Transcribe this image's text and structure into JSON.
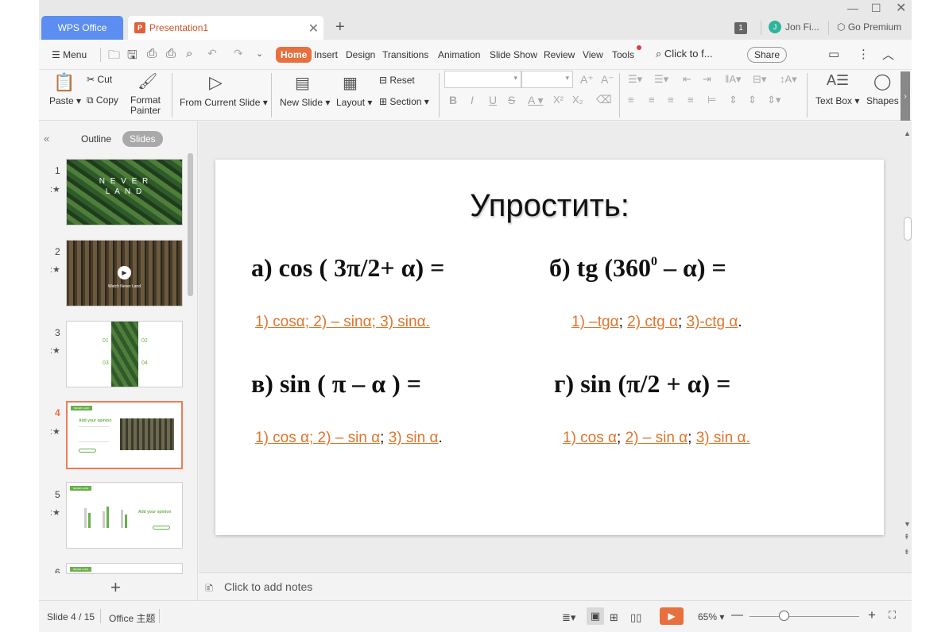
{
  "titlebar": {
    "app_tab": "WPS Office",
    "doc_tab": "Presentation1",
    "doc_icon": "P",
    "badge": "1",
    "user_initial": "J",
    "user_name": "Jon Fi...",
    "premium": "Go Premium"
  },
  "menu": {
    "menu_label": "Menu",
    "items": [
      "Home",
      "Insert",
      "Design",
      "Transitions",
      "Animation",
      "Slide Show",
      "Review",
      "View",
      "Tools"
    ],
    "search": "Click to f...",
    "share": "Share"
  },
  "ribbon": {
    "paste": "Paste",
    "cut": "Cut",
    "copy": "Copy",
    "format_painter_1": "Format",
    "format_painter_2": "Painter",
    "from_current_slide": "From Current Slide",
    "new_slide": "New Slide",
    "layout": "Layout",
    "reset": "Reset",
    "section": "Section",
    "text_box": "Text Box",
    "shapes": "Shapes"
  },
  "panel": {
    "outline": "Outline",
    "slides": "Slides",
    "slide_numbers": [
      "1",
      "2",
      "3",
      "4",
      "5",
      "6"
    ],
    "thumb1_title_1": "N E V E R",
    "thumb1_title_2": "L A N D",
    "thumb2_caption": "Watch Never Land",
    "thumb3_labels": [
      "01",
      "02",
      "03",
      "04"
    ],
    "thumb4_heading": "Add your opinion",
    "thumb5_heading": "Add your opinion",
    "tag_text": "NEVER LAND"
  },
  "slide": {
    "title": "Упростить:",
    "q_a": "а) cos ( 3π/2+ α) =",
    "q_b_pre": "б)  tg (360",
    "q_b_sup": "0",
    "q_b_post": " – α) =",
    "q_c": "в) sin ( π – α ) =",
    "q_d": "г) sin (π/2 + α) =",
    "ans_a": "1) cosα; 2) – sinα; 3) sinα.",
    "ans_b_1": "1) –tgα",
    "ans_b_sep1": "; ",
    "ans_b_2": "2) ctg α",
    "ans_b_sep2": ";  ",
    "ans_b_3": "3)-ctg α",
    "ans_b_end": ".",
    "ans_c_1": "1) cos α;  2) – sin α",
    "ans_c_sep": ";  ",
    "ans_c_2": "3) sin α",
    "ans_c_end": ".",
    "ans_d_1": "1) cos α",
    "ans_d_sep1": ";  ",
    "ans_d_2": "2) – sin α",
    "ans_d_sep2": ";  ",
    "ans_d_3": "3) sin α."
  },
  "notes": {
    "placeholder": "Click to add notes"
  },
  "status": {
    "slide_count": "Slide 4 / 15",
    "theme": "Office 主题",
    "zoom": "65%"
  },
  "colors": {
    "accent": "#e8703f",
    "answer": "#e0742b",
    "wps_tab": "#5b8ef0"
  }
}
